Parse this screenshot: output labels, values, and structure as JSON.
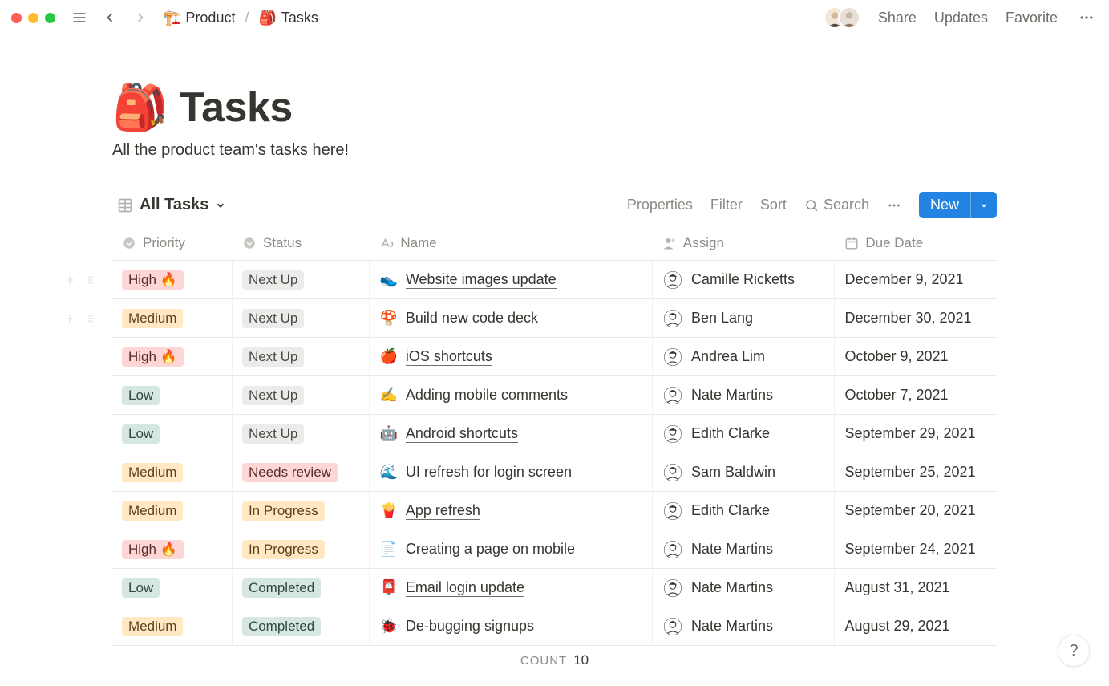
{
  "topbar": {
    "breadcrumb": [
      {
        "icon": "🏗️",
        "label": "Product"
      },
      {
        "icon": "🎒",
        "label": "Tasks"
      }
    ],
    "share": "Share",
    "updates": "Updates",
    "favorite": "Favorite"
  },
  "page": {
    "icon": "🎒",
    "title": "Tasks",
    "description": "All the product team's tasks here!"
  },
  "view": {
    "name": "All Tasks",
    "properties": "Properties",
    "filter": "Filter",
    "sort": "Sort",
    "search": "Search",
    "new": "New"
  },
  "columns": {
    "priority": "Priority",
    "status": "Status",
    "name": "Name",
    "assign": "Assign",
    "due": "Due Date"
  },
  "priority_labels": {
    "high": "High 🔥",
    "medium": "Medium",
    "low": "Low"
  },
  "status_labels": {
    "nextup": "Next Up",
    "needsreview": "Needs review",
    "inprogress": "In Progress",
    "completed": "Completed"
  },
  "rows": [
    {
      "priority": "high",
      "status": "nextup",
      "icon": "👟",
      "name": "Website images update",
      "assign": "Camille Ricketts",
      "due": "December 9, 2021"
    },
    {
      "priority": "medium",
      "status": "nextup",
      "icon": "🍄",
      "name": "Build new code deck",
      "assign": "Ben Lang",
      "due": "December 30, 2021"
    },
    {
      "priority": "high",
      "status": "nextup",
      "icon": "🍎",
      "name": "iOS shortcuts",
      "assign": "Andrea Lim",
      "due": "October 9, 2021"
    },
    {
      "priority": "low",
      "status": "nextup",
      "icon": "✍️",
      "name": "Adding mobile comments",
      "assign": "Nate Martins",
      "due": "October 7, 2021"
    },
    {
      "priority": "low",
      "status": "nextup",
      "icon": "🤖",
      "name": "Android shortcuts",
      "assign": "Edith Clarke",
      "due": "September 29, 2021"
    },
    {
      "priority": "medium",
      "status": "needsreview",
      "icon": "🌊",
      "name": "UI refresh for login screen",
      "assign": "Sam Baldwin",
      "due": "September 25, 2021"
    },
    {
      "priority": "medium",
      "status": "inprogress",
      "icon": "🍟",
      "name": "App refresh",
      "assign": "Edith Clarke",
      "due": "September 20, 2021"
    },
    {
      "priority": "high",
      "status": "inprogress",
      "icon": "📄",
      "name": "Creating a page on mobile",
      "assign": "Nate Martins",
      "due": "September 24, 2021"
    },
    {
      "priority": "low",
      "status": "completed",
      "icon": "📮",
      "name": "Email login update",
      "assign": "Nate Martins",
      "due": "August 31, 2021"
    },
    {
      "priority": "medium",
      "status": "completed",
      "icon": "🐞",
      "name": "De-bugging signups",
      "assign": "Nate Martins",
      "due": "August 29, 2021"
    }
  ],
  "footer": {
    "label": "COUNT",
    "value": "10"
  },
  "help": "?"
}
